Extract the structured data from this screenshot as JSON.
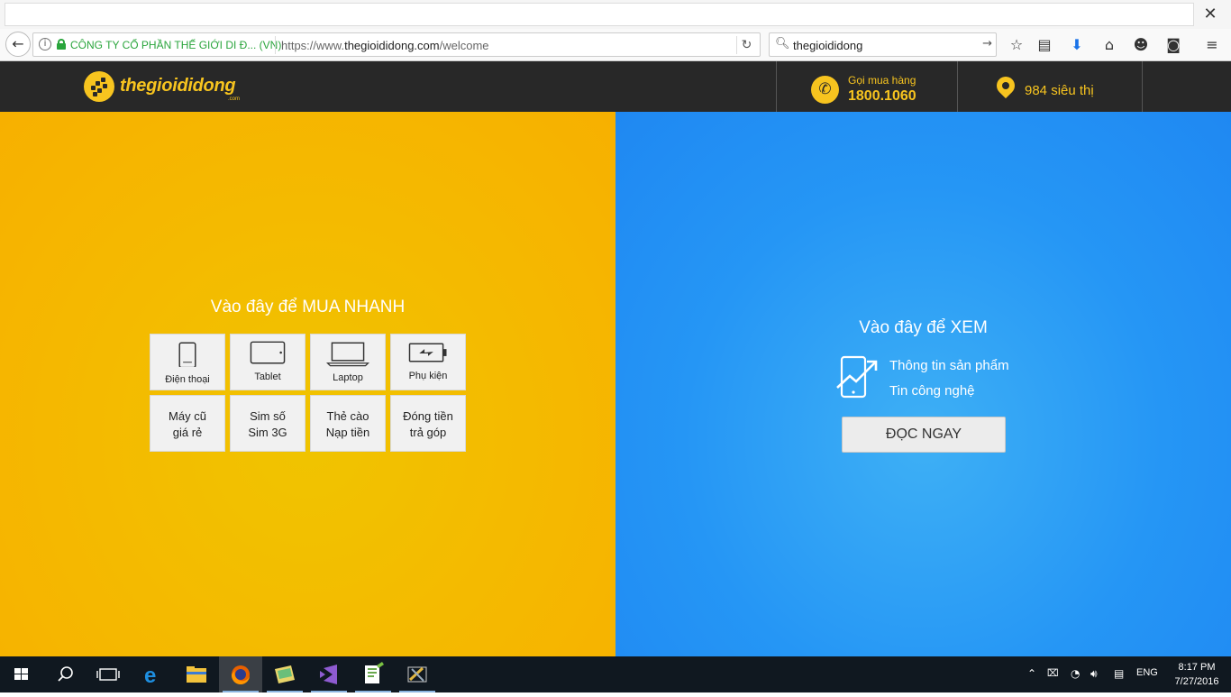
{
  "browser": {
    "company_label": "CÔNG TY CỔ PHẦN THẾ GIỚI DI Đ...  (VN)",
    "url_prefix": "https://www.",
    "url_domain": "thegioididong.com",
    "url_path": "/welcome",
    "search_value": "thegioididong"
  },
  "header": {
    "logo_text": "thegioididong",
    "logo_sub": ".com",
    "call_label": "Gọi mua hàng",
    "call_number": "1800.1060",
    "stores_label": "984 siêu thị"
  },
  "buy": {
    "title": "Vào đây để MUA NHANH",
    "tiles": [
      {
        "label": "Điện thoại",
        "icon": "phone-icon"
      },
      {
        "label": "Tablet",
        "icon": "tablet-icon"
      },
      {
        "label": "Laptop",
        "icon": "laptop-icon"
      },
      {
        "label": "Phụ kiện",
        "icon": "battery-icon"
      }
    ],
    "tiles2": [
      {
        "line1": "Máy cũ",
        "line2": "giá rẻ"
      },
      {
        "line1": "Sim số",
        "line2": "Sim 3G"
      },
      {
        "line1": "Thẻ cào",
        "line2": "Nạp tiền"
      },
      {
        "line1": "Đóng tiền",
        "line2": "trả góp"
      }
    ]
  },
  "read": {
    "title": "Vào đây để XEM",
    "line1": "Thông tin sản phẩm",
    "line2": "Tin công nghệ",
    "button": "ĐỌC NGAY"
  },
  "taskbar": {
    "language": "ENG",
    "time": "8:17 PM",
    "date": "7/27/2016"
  },
  "colors": {
    "brand_yellow": "#f7c41f",
    "header_bg": "#282828",
    "left_panel": "#f5b800",
    "right_panel": "#2596f5"
  }
}
